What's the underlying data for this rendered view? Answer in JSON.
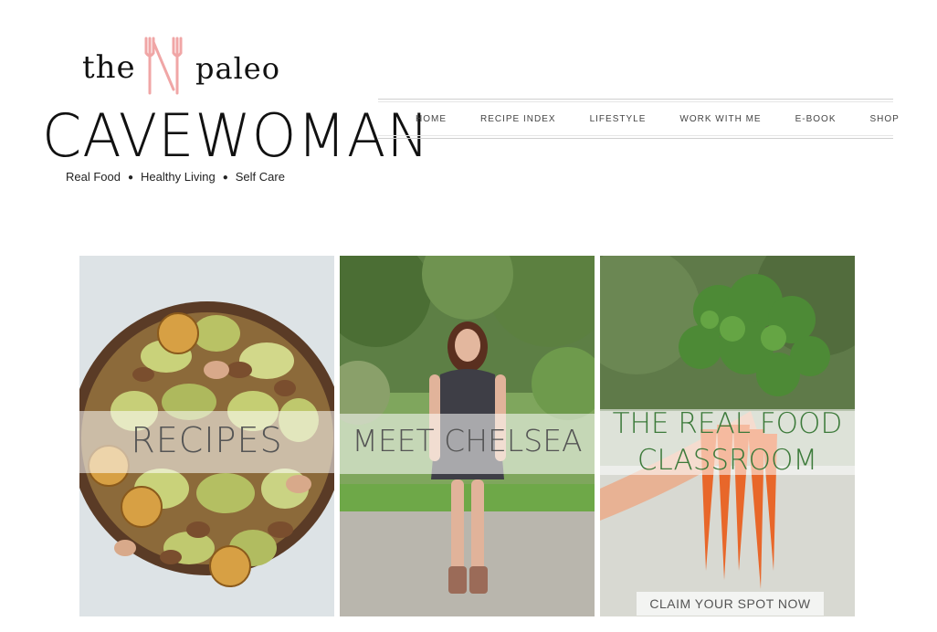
{
  "logo": {
    "word_the": "the",
    "word_paleo": "paleo",
    "word_cavewoman": "CAVEWOMAN",
    "tagline": [
      "Real Food",
      "Healthy Living",
      "Self Care"
    ],
    "accent_color": "#f0a6a6"
  },
  "nav": {
    "items": [
      "HOME",
      "RECIPE INDEX",
      "LIFESTYLE",
      "WORK WITH ME",
      "E-BOOK",
      "SHOP"
    ]
  },
  "tiles": {
    "recipes": {
      "label": "RECIPES"
    },
    "meet": {
      "label": "MEET CHELSEA"
    },
    "classroom": {
      "line1": "THE REAL FOOD",
      "line2": "CLASSROOM",
      "cta": "CLAIM YOUR SPOT NOW",
      "label_color": "#3c7a3a"
    }
  }
}
